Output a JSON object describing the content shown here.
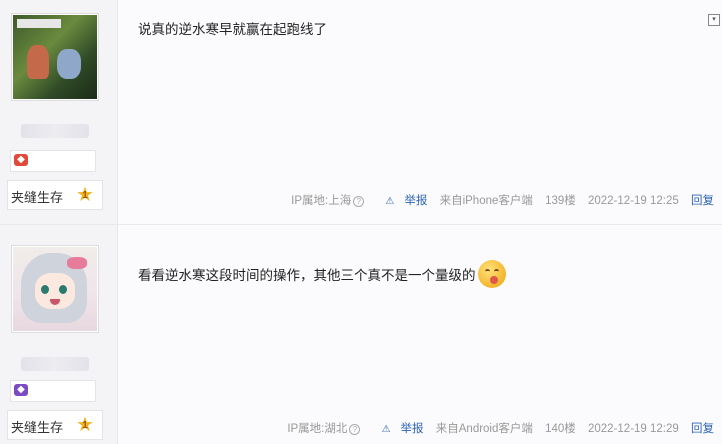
{
  "posts": [
    {
      "text": "说真的逆水寒早就赢在起跑线了",
      "level_name": "夹缝生存",
      "level_num": "1",
      "ip_label": "IP属地:上海",
      "report": "举报",
      "client": "来自iPhone客户端",
      "floor": "139楼",
      "time": "2022-12-19 12:25",
      "reply": "回复"
    },
    {
      "text": "看看逆水寒这段时间的操作，其他三个真不是一个量级的",
      "level_name": "夹缝生存",
      "level_num": "1",
      "ip_label": "IP属地:湖北",
      "report": "举报",
      "client": "来自Android客户端",
      "floor": "140楼",
      "time": "2022-12-19 12:29",
      "reply": "回复"
    }
  ],
  "icons": {
    "help": "?",
    "report": "⚠",
    "star": "★",
    "menu": "▾"
  },
  "colors": {
    "link": "#2d64b3",
    "meta": "#999999",
    "star": "#f2b21b"
  }
}
